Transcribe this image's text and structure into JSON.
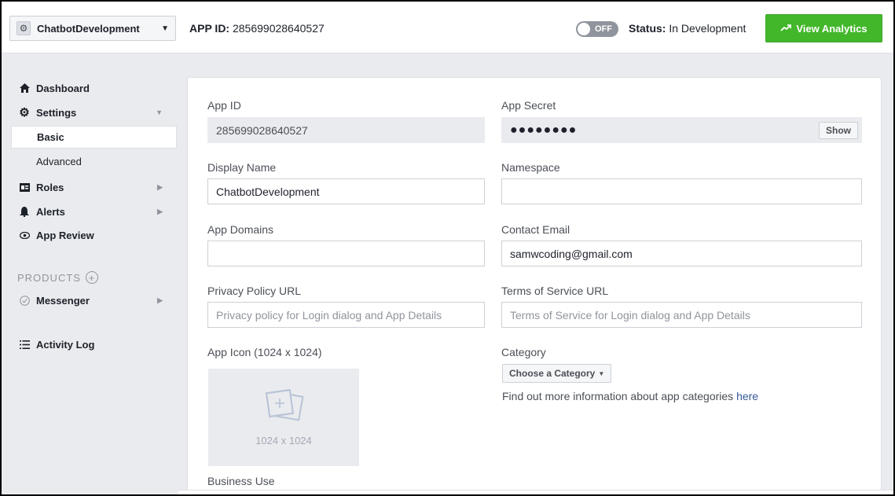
{
  "header": {
    "app_name": "ChatbotDevelopment",
    "app_id_label": "APP ID:",
    "app_id_value": "285699028640527",
    "toggle_label": "OFF",
    "status_label": "Status:",
    "status_value": "In Development",
    "analytics_button": "View Analytics"
  },
  "sidebar": {
    "dashboard": "Dashboard",
    "settings": "Settings",
    "basic": "Basic",
    "advanced": "Advanced",
    "roles": "Roles",
    "alerts": "Alerts",
    "app_review": "App Review",
    "products_header": "PRODUCTS",
    "messenger": "Messenger",
    "activity_log": "Activity Log"
  },
  "form": {
    "app_id": {
      "label": "App ID",
      "value": "285699028640527"
    },
    "app_secret": {
      "label": "App Secret",
      "value": "●●●●●●●●",
      "show_button": "Show"
    },
    "display_name": {
      "label": "Display Name",
      "value": "ChatbotDevelopment"
    },
    "namespace": {
      "label": "Namespace",
      "value": ""
    },
    "app_domains": {
      "label": "App Domains",
      "value": ""
    },
    "contact_email": {
      "label": "Contact Email",
      "value": "samwcoding@gmail.com"
    },
    "privacy_policy": {
      "label": "Privacy Policy URL",
      "placeholder": "Privacy policy for Login dialog and App Details"
    },
    "terms_of_service": {
      "label": "Terms of Service URL",
      "placeholder": "Terms of Service for Login dialog and App Details"
    },
    "app_icon": {
      "label": "App Icon (1024 x 1024)",
      "size_text": "1024 x 1024"
    },
    "category": {
      "label": "Category",
      "button": "Choose a Category",
      "note": "Find out more information about app categories",
      "link": "here"
    },
    "business_use": {
      "label": "Business Use"
    }
  },
  "colors": {
    "accent_green": "#42b72a",
    "link_blue": "#365899",
    "background": "#e9ebee"
  }
}
